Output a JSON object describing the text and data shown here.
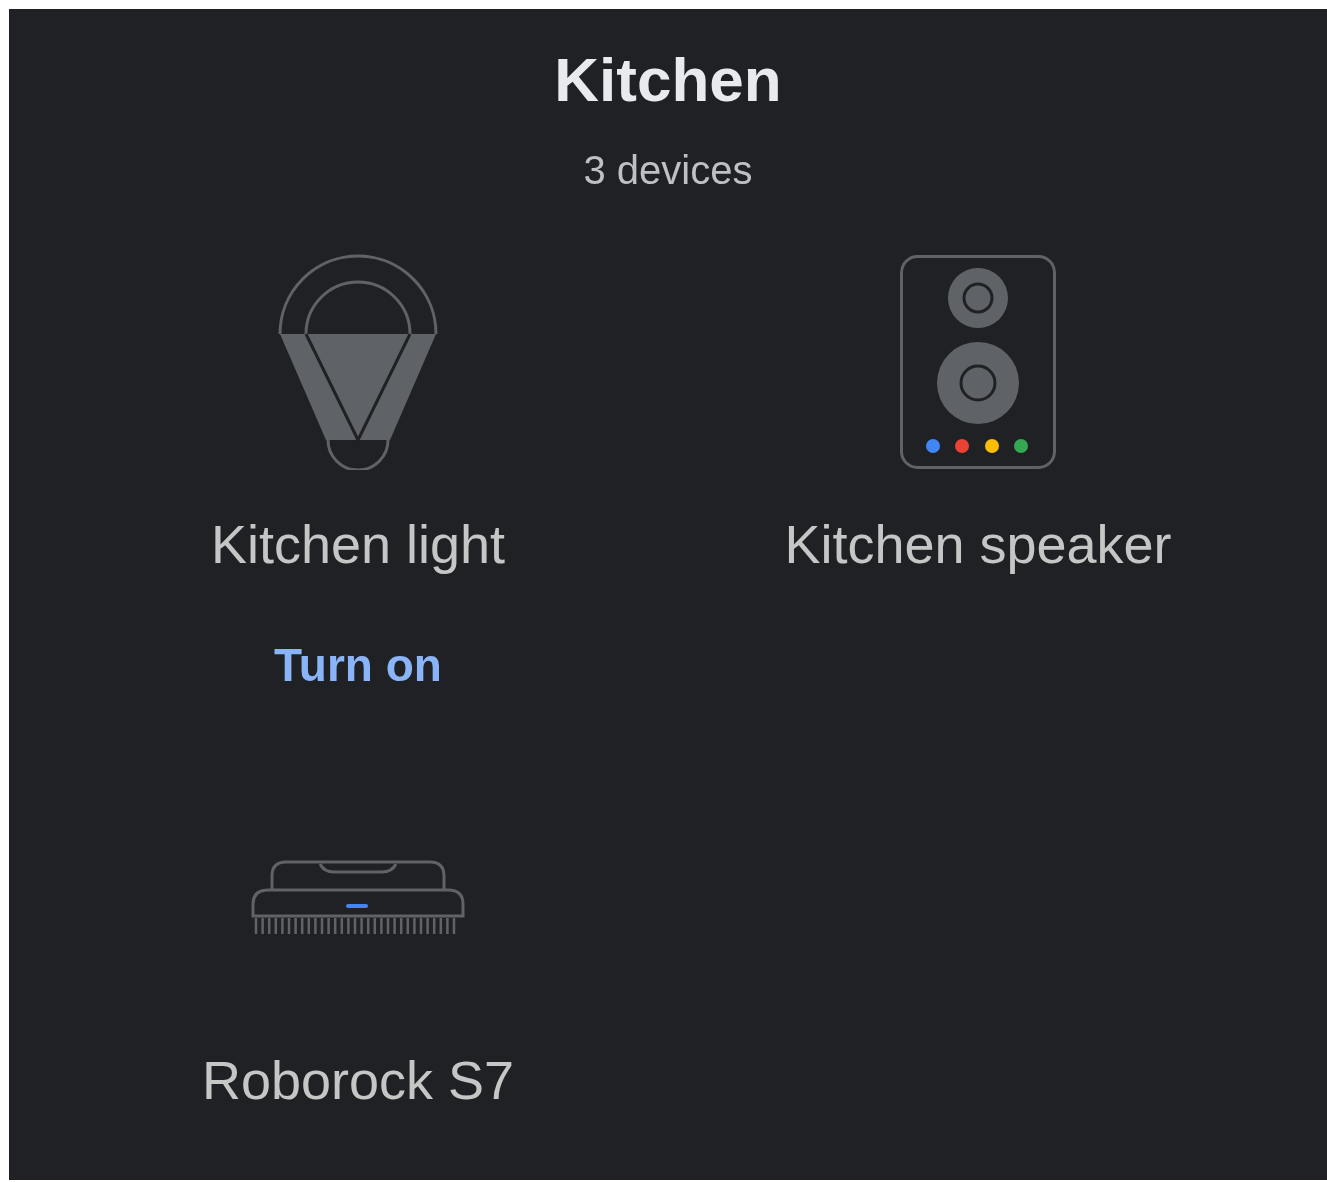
{
  "room": {
    "title": "Kitchen",
    "subtitle": "3 devices"
  },
  "devices": [
    {
      "kind": "light",
      "name": "Kitchen light",
      "action": "Turn on"
    },
    {
      "kind": "speaker",
      "name": "Kitchen speaker"
    },
    {
      "kind": "vacuum",
      "name": "Roborock S7"
    }
  ]
}
